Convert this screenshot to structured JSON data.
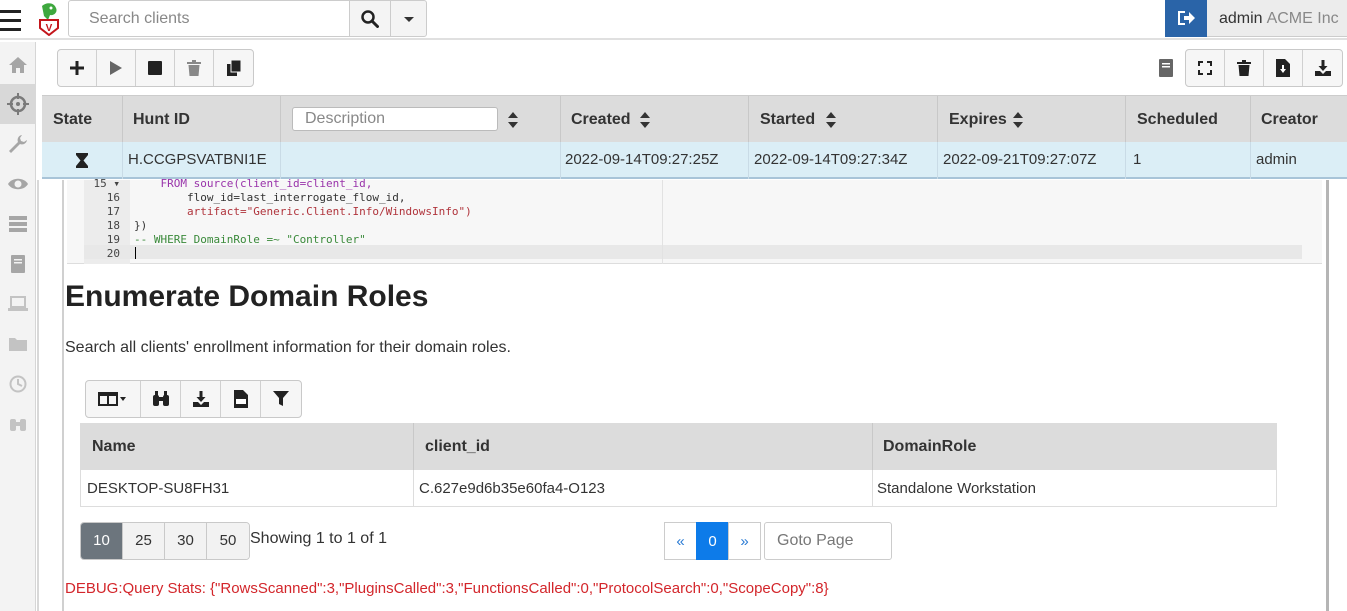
{
  "search": {
    "placeholder": "Search clients"
  },
  "user": {
    "name": "admin",
    "org": "ACME Inc"
  },
  "hunt_table": {
    "columns": [
      "State",
      "Hunt ID",
      "Created",
      "Started",
      "Expires",
      "Scheduled",
      "Creator"
    ],
    "description_placeholder": "Description",
    "row": {
      "hunt_id": "H.CCGPSVATBNI1E",
      "created": "2022-09-14T09:27:25Z",
      "started": "2022-09-14T09:27:34Z",
      "expires": "2022-09-21T09:27:07Z",
      "scheduled": "1",
      "creator": "admin"
    }
  },
  "editor": {
    "lines": [
      {
        "n": "15 ▾",
        "text": "    FROM source(client_id=client_id,"
      },
      {
        "n": "16",
        "text": "        flow_id=last_interrogate_flow_id,"
      },
      {
        "n": "17",
        "text": "        artifact=\"Generic.Client.Info/WindowsInfo\")"
      },
      {
        "n": "18",
        "text": "})"
      },
      {
        "n": "19",
        "text": "-- WHERE DomainRole =~ \"Controller\""
      },
      {
        "n": "20",
        "text": ""
      }
    ]
  },
  "report": {
    "title": "Enumerate Domain Roles",
    "description": "Search all clients' enrollment information for their domain roles."
  },
  "results": {
    "columns": [
      "Name",
      "client_id",
      "DomainRole"
    ],
    "rows": [
      {
        "name": "DESKTOP-SU8FH31",
        "client_id": "C.627e9d6b35e60fa4-O123",
        "domain_role": "Standalone Workstation"
      }
    ]
  },
  "pagination": {
    "sizes": [
      "10",
      "25",
      "30",
      "50"
    ],
    "showing": "Showing 1 to 1 of 1",
    "prev": "«",
    "current": "0",
    "next": "»",
    "goto_placeholder": "Goto Page"
  },
  "debug": "DEBUG:Query Stats: {\"RowsScanned\":3,\"PluginsCalled\":3,\"FunctionsCalled\":0,\"ProtocolSearch\":0,\"ScopeCopy\":8}",
  "icons": {
    "sidebar": [
      "home-icon",
      "crosshair-icon",
      "wrench-icon",
      "eye-icon",
      "server-icon",
      "book-icon",
      "laptop-icon",
      "folder-icon",
      "history-icon",
      "binoculars-icon"
    ],
    "hunt_toolbar": [
      "plus-icon",
      "play-icon",
      "stop-icon",
      "trash-icon",
      "copy-icon",
      "notebook-icon",
      "fullscreen-icon",
      "delete-icon",
      "download-file-icon",
      "download-icon"
    ],
    "result_toolbar": [
      "columns-icon",
      "binoculars-icon",
      "download-icon",
      "csv-icon",
      "filter-icon"
    ]
  }
}
